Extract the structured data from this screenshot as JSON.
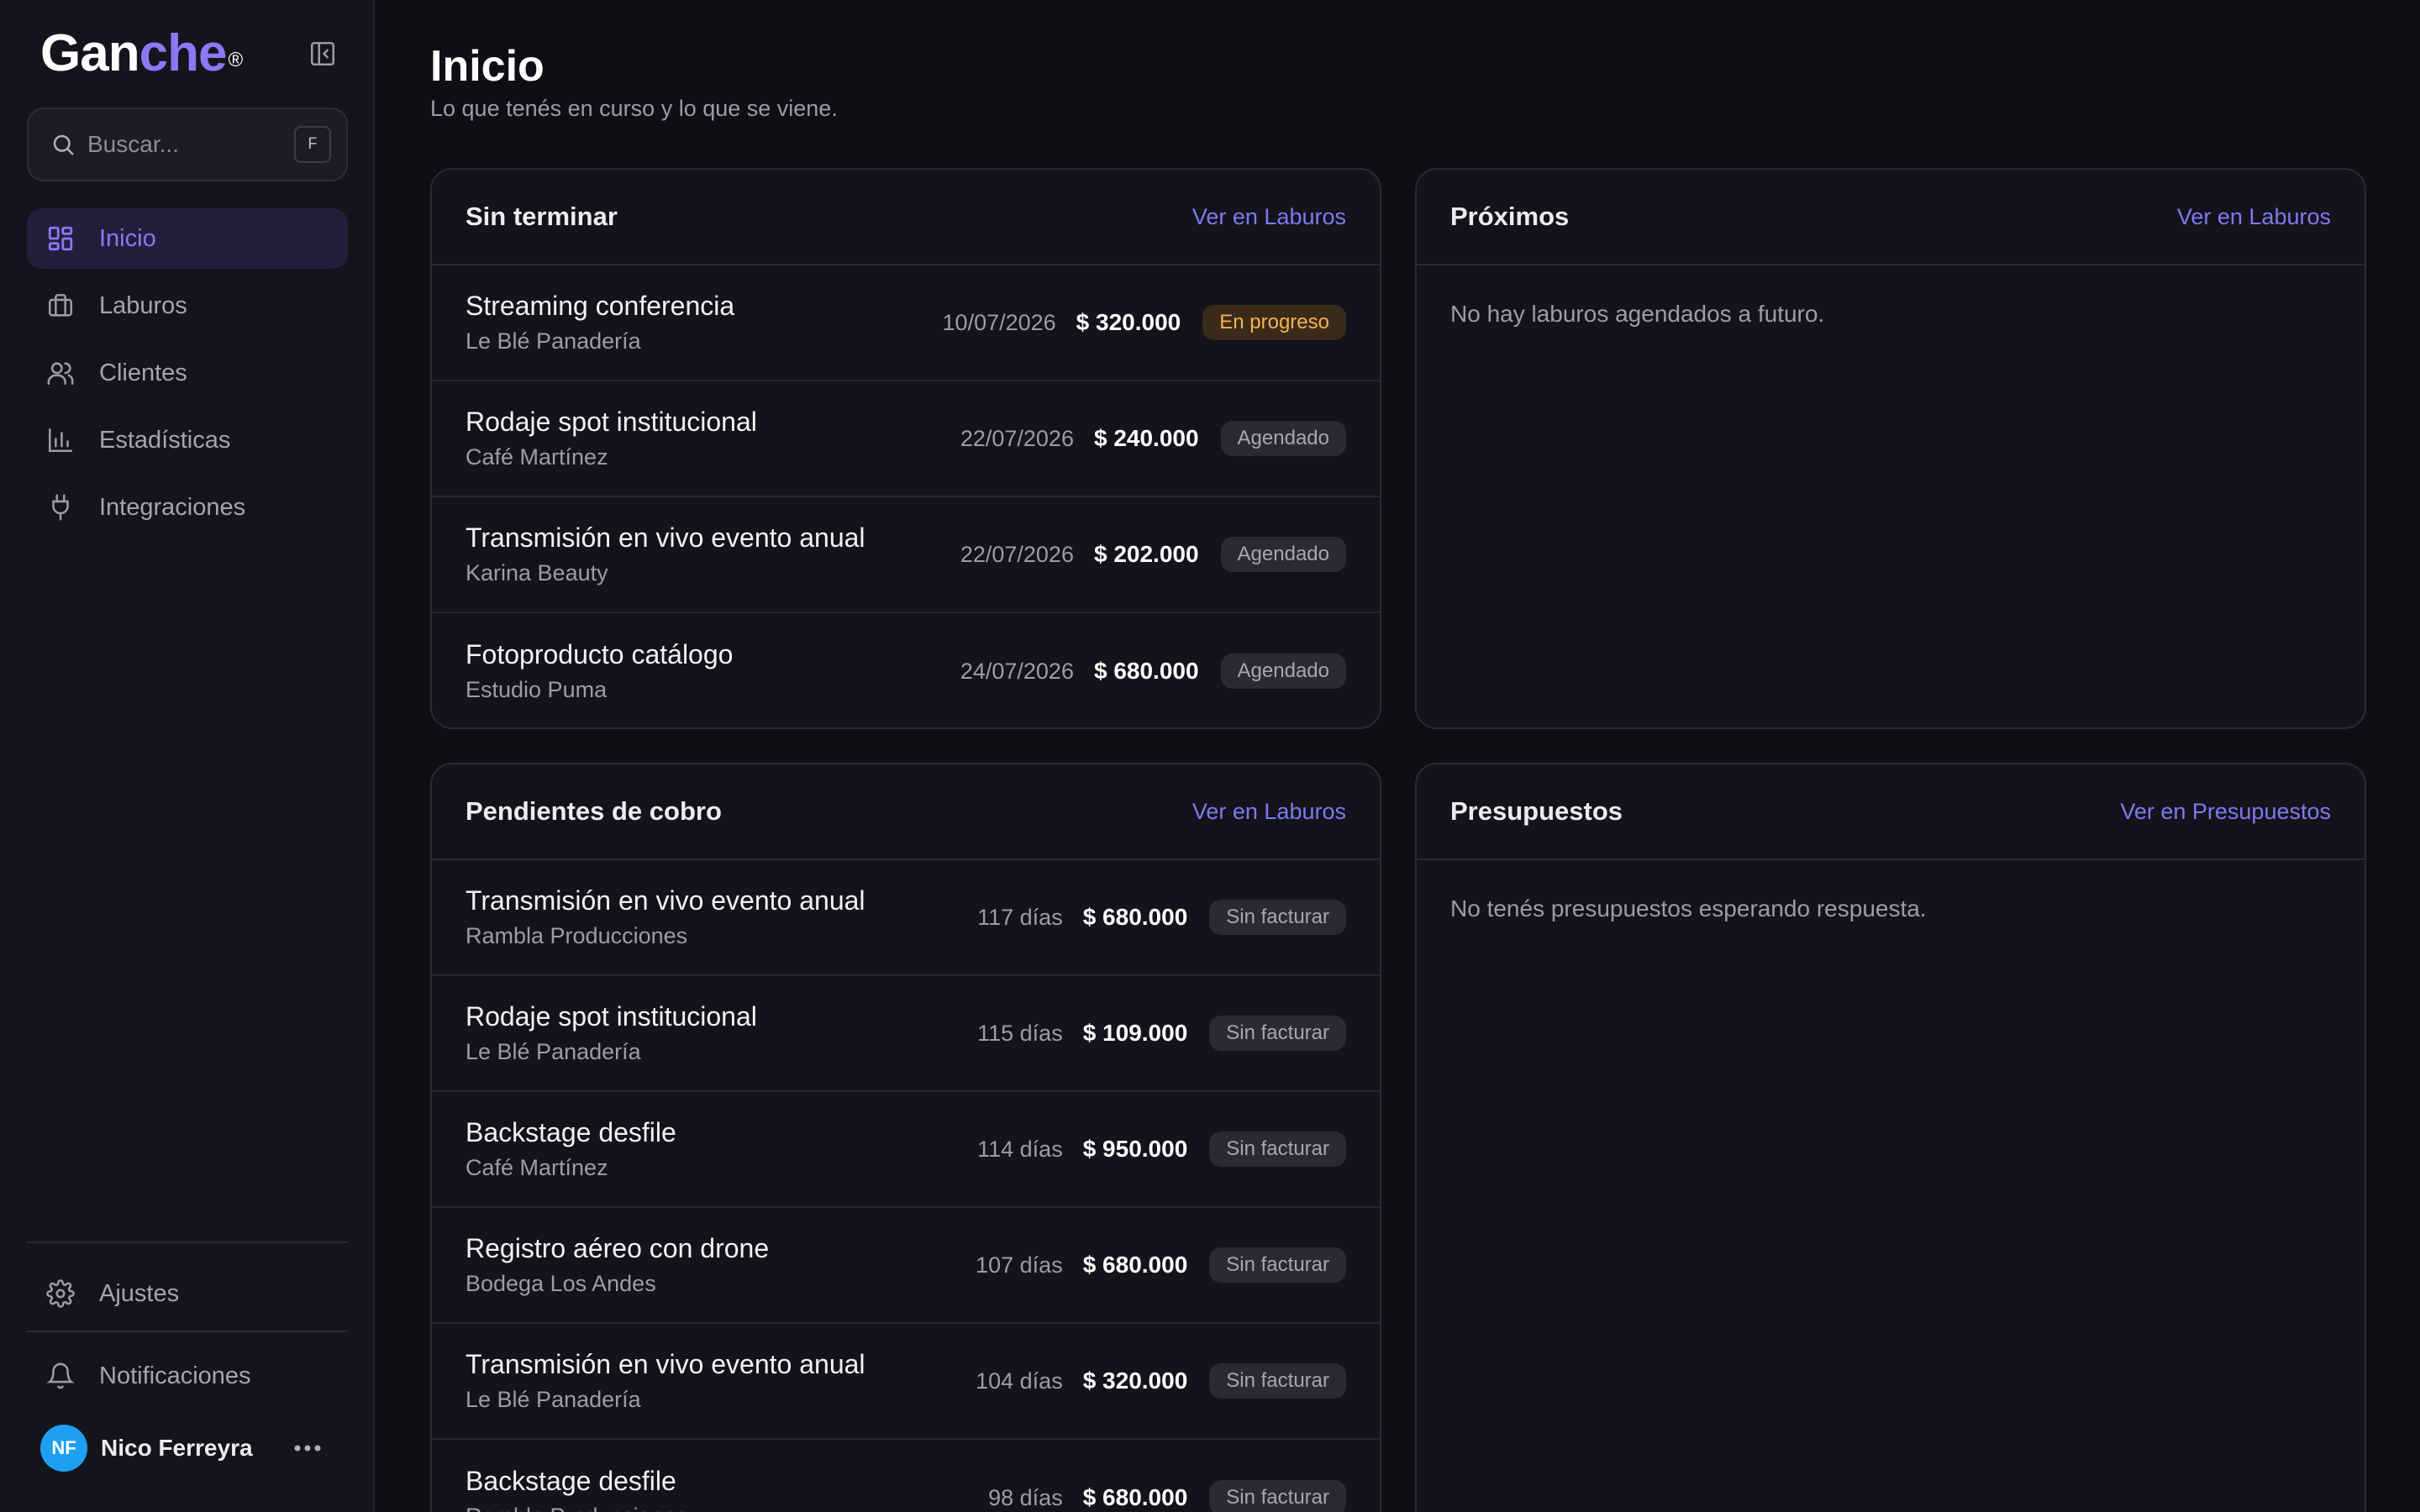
{
  "brand": {
    "name_prefix": "Gan",
    "name_accent": "che",
    "mark": "®"
  },
  "search": {
    "placeholder": "Buscar...",
    "shortcut": "F"
  },
  "nav": {
    "items": [
      {
        "label": "Inicio",
        "icon": "grid-icon",
        "active": true
      },
      {
        "label": "Laburos",
        "icon": "briefcase-icon"
      },
      {
        "label": "Clientes",
        "icon": "users-icon"
      },
      {
        "label": "Estadísticas",
        "icon": "bar-chart-icon"
      },
      {
        "label": "Integraciones",
        "icon": "plug-icon"
      }
    ],
    "settings": "Ajustes",
    "notifications": "Notificaciones"
  },
  "user": {
    "initials": "NF",
    "name": "Nico Ferreyra"
  },
  "page": {
    "title": "Inicio",
    "subtitle": "Lo que tenés en curso y lo que se viene."
  },
  "unfinished": {
    "title": "Sin terminar",
    "link": "Ver en Laburos",
    "rows": [
      {
        "title": "Streaming conferencia",
        "client": "Le Blé Panadería",
        "date": "10/07/2026",
        "amount": "$ 320.000",
        "status": "En progreso"
      },
      {
        "title": "Rodaje spot institucional",
        "client": "Café Martínez",
        "date": "22/07/2026",
        "amount": "$ 240.000",
        "status": "Agendado"
      },
      {
        "title": "Transmisión en vivo evento anual",
        "client": "Karina Beauty",
        "date": "22/07/2026",
        "amount": "$ 202.000",
        "status": "Agendado"
      },
      {
        "title": "Fotoproducto catálogo",
        "client": "Estudio Puma",
        "date": "24/07/2026",
        "amount": "$ 680.000",
        "status": "Agendado"
      }
    ]
  },
  "upcoming": {
    "title": "Próximos",
    "link": "Ver en Laburos",
    "empty": "No hay laburos agendados a futuro."
  },
  "pending": {
    "title": "Pendientes de cobro",
    "link": "Ver en Laburos",
    "rows": [
      {
        "title": "Transmisión en vivo evento anual",
        "client": "Rambla Producciones",
        "days": "117 días",
        "amount": "$ 680.000",
        "status": "Sin facturar"
      },
      {
        "title": "Rodaje spot institucional",
        "client": "Le Blé Panadería",
        "days": "115 días",
        "amount": "$ 109.000",
        "status": "Sin facturar"
      },
      {
        "title": "Backstage desfile",
        "client": "Café Martínez",
        "days": "114 días",
        "amount": "$ 950.000",
        "status": "Sin facturar"
      },
      {
        "title": "Registro aéreo con drone",
        "client": "Bodega Los Andes",
        "days": "107 días",
        "amount": "$ 680.000",
        "status": "Sin facturar"
      },
      {
        "title": "Transmisión en vivo evento anual",
        "client": "Le Blé Panadería",
        "days": "104 días",
        "amount": "$ 320.000",
        "status": "Sin facturar"
      },
      {
        "title": "Backstage desfile",
        "client": "Rambla Producciones",
        "days": "98 días",
        "amount": "$ 680.000",
        "status": "Sin facturar"
      }
    ]
  },
  "quotes": {
    "title": "Presupuestos",
    "link": "Ver en Presupuestos",
    "empty": "No tenés presupuestos esperando respuesta."
  },
  "colors": {
    "accent": "#8b78f5",
    "background": "#0e0e14",
    "sidebar": "#14141d",
    "card": "#13131b",
    "in_progress": "#f5b34e",
    "avatar": "#1ea0f0"
  }
}
